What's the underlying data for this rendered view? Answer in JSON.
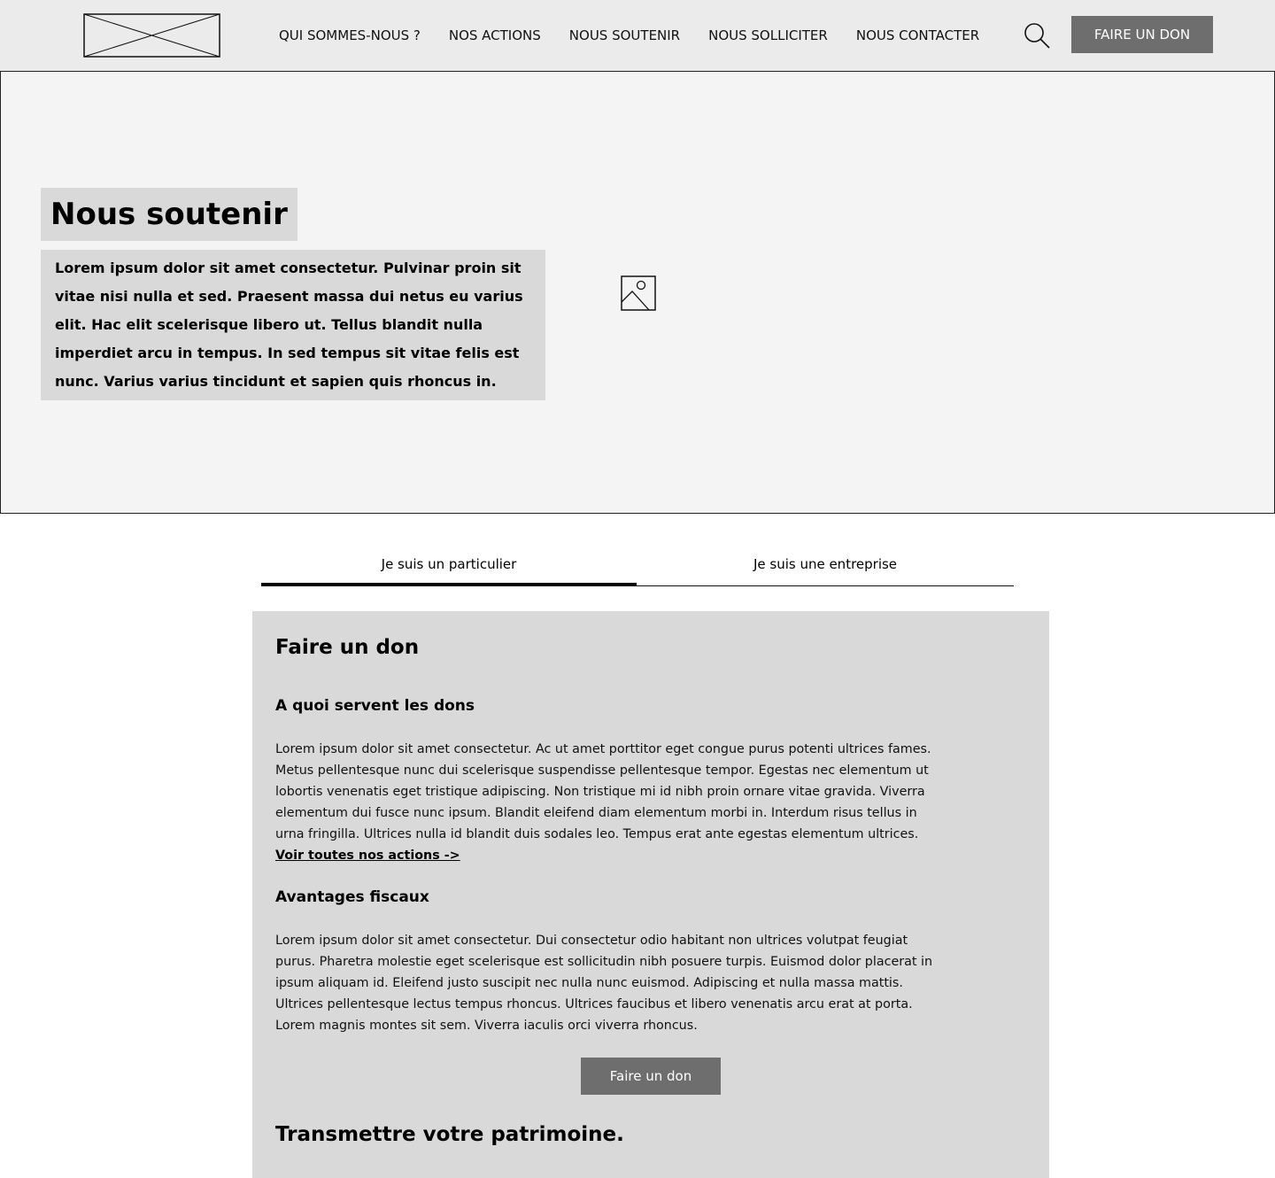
{
  "header": {
    "nav": [
      {
        "label": "QUI SOMMES-NOUS ?"
      },
      {
        "label": "NOS ACTIONS"
      },
      {
        "label": "NOUS SOUTENIR"
      },
      {
        "label": "NOUS SOLLICITER"
      },
      {
        "label": "NOUS CONTACTER"
      }
    ],
    "cta_label": "FAIRE UN DON",
    "logo_icon": "logo-placeholder-icon",
    "search_icon": "search-icon"
  },
  "hero": {
    "title": "Nous soutenir",
    "text": "Lorem ipsum dolor sit amet consectetur. Pulvinar proin sit vitae nisi nulla et sed. Praesent massa dui netus eu varius elit. Hac elit scelerisque libero ut. Tellus blandit nulla imperdiet arcu in tempus. In sed tempus sit vitae felis est nunc. Varius varius tincidunt et sapien quis rhoncus in.",
    "image_icon": "image-placeholder-icon"
  },
  "tabs": [
    {
      "label": "Je suis un particulier",
      "active": true
    },
    {
      "label": "Je suis une entreprise",
      "active": false
    }
  ],
  "panel": {
    "title": "Faire un don",
    "section1": {
      "title": "A quoi servent les dons",
      "text": "Lorem ipsum dolor sit amet consectetur. Ac ut amet porttitor eget congue purus potenti ultrices fames. Metus pellentesque nunc dui scelerisque suspendisse pellentesque tempor. Egestas nec elementum ut lobortis venenatis eget tristique adipiscing. Non tristique mi id nibh proin ornare vitae gravida. Viverra elementum dui fusce nunc ipsum. Blandit eleifend diam elementum morbi in. Interdum risus tellus in urna fringilla. Ultrices nulla id blandit duis sodales leo. Tempus erat ante egestas elementum ultrices. ",
      "link": "Voir toutes nos actions ->"
    },
    "section2": {
      "title": "Avantages fiscaux",
      "text": "Lorem ipsum dolor sit amet consectetur. Dui consectetur odio habitant non ultrices volutpat feugiat purus. Pharetra molestie eget scelerisque est sollicitudin nibh posuere turpis. Euismod dolor placerat in ipsum aliquam id. Eleifend justo suscipit nec nulla nunc euismod. Adipiscing et nulla massa mattis. Ultrices pellentesque lectus tempus rhoncus. Ultrices faucibus et libero venenatis arcu erat at porta. Lorem magnis montes sit sem. Viverra iaculis orci viverra rhoncus."
    },
    "cta_label": "Faire un don",
    "next_title": "Transmettre votre patrimoine."
  },
  "colors": {
    "header_bg": "#ebebeb",
    "hero_bg": "#f4f4f4",
    "block_bg": "#d9d9d9",
    "button_bg": "#6e6e6e",
    "button_text": "#ffffff"
  }
}
